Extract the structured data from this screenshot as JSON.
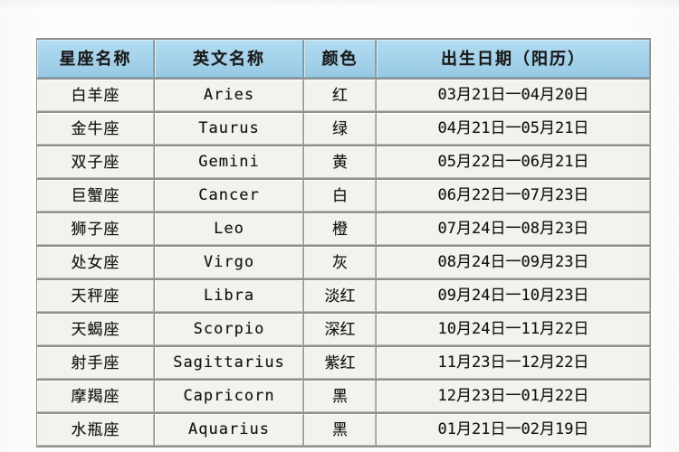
{
  "top_sliver": {
    "ghost_text": "·····   ··   ····"
  },
  "table": {
    "columns": [
      {
        "key": "name",
        "label": "星座名称"
      },
      {
        "key": "en",
        "label": "英文名称"
      },
      {
        "key": "color",
        "label": "颜色"
      },
      {
        "key": "date",
        "label": "出生日期（阳历）"
      }
    ],
    "rows": [
      {
        "name": "白羊座",
        "en": "Aries",
        "color": "红",
        "date": "03月21日一04月20日"
      },
      {
        "name": "金牛座",
        "en": "Taurus",
        "color": "绿",
        "date": "04月21日一05月21日"
      },
      {
        "name": "双子座",
        "en": "Gemini",
        "color": "黄",
        "date": "05月22日一06月21日"
      },
      {
        "name": "巨蟹座",
        "en": "Cancer",
        "color": "白",
        "date": "06月22日一07月23日"
      },
      {
        "name": "狮子座",
        "en": "Leo",
        "color": "橙",
        "date": "07月24日一08月23日"
      },
      {
        "name": "处女座",
        "en": "Virgo",
        "color": "灰",
        "date": "08月24日一09月23日"
      },
      {
        "name": "天秤座",
        "en": "Libra",
        "color": "淡红",
        "date": "09月24日一10月23日"
      },
      {
        "name": "天蝎座",
        "en": "Scorpio",
        "color": "深红",
        "date": "10月24日一11月22日"
      },
      {
        "name": "射手座",
        "en": "Sagittarius",
        "color": "紫红",
        "date": "11月23日一12月22日"
      },
      {
        "name": "摩羯座",
        "en": "Capricorn",
        "color": "黑",
        "date": "12月23日一01月22日"
      },
      {
        "name": "水瓶座",
        "en": "Aquarius",
        "color": "黑",
        "date": "01月21日一02月19日"
      }
    ]
  },
  "colors": {
    "header_blue": "#a4d2ea",
    "cell_bg": "#f2f2ee",
    "border": "#b9bbb6",
    "text": "#131313",
    "page_bg": "#fdfdfc"
  }
}
